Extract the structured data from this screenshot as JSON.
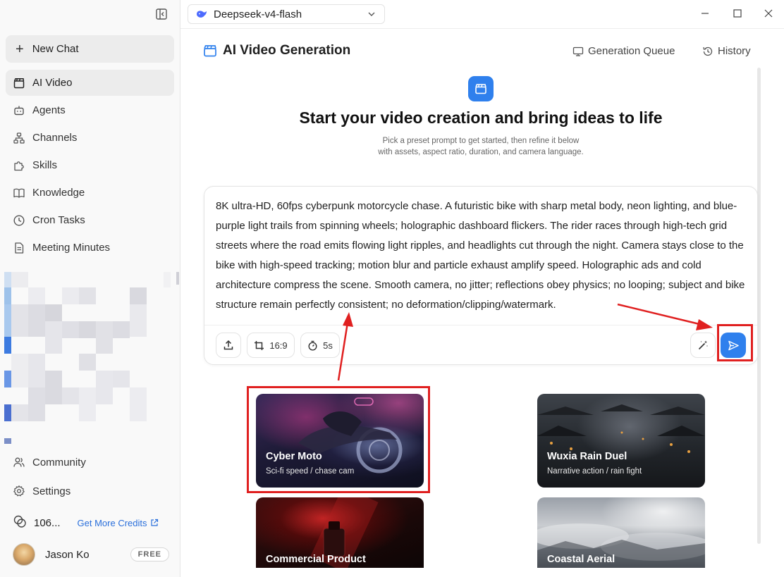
{
  "window": {
    "model_name": "Deepseek-v4-flash"
  },
  "sidebar": {
    "new_chat": "New Chat",
    "items": [
      {
        "label": "AI Video",
        "icon": "clapperboard-icon"
      },
      {
        "label": "Agents",
        "icon": "robot-icon"
      },
      {
        "label": "Channels",
        "icon": "network-icon"
      },
      {
        "label": "Skills",
        "icon": "puzzle-icon"
      },
      {
        "label": "Knowledge",
        "icon": "book-icon"
      },
      {
        "label": "Cron Tasks",
        "icon": "clock-icon"
      },
      {
        "label": "Meeting Minutes",
        "icon": "document-icon"
      }
    ],
    "bottom_items": [
      {
        "label": "Community",
        "icon": "users-icon"
      },
      {
        "label": "Settings",
        "icon": "gear-icon"
      }
    ],
    "credits_count": "106...",
    "get_more_credits": "Get More Credits",
    "user_name": "Jason Ko",
    "plan_badge": "FREE"
  },
  "header": {
    "title": "AI Video Generation",
    "generation_queue": "Generation Queue",
    "history": "History"
  },
  "hero": {
    "title": "Start your video creation and bring ideas to life",
    "subtitle_line1": "Pick a preset prompt to get started, then refine it below",
    "subtitle_line2": "with assets, aspect ratio, duration, and camera language."
  },
  "prompt": {
    "text": "8K ultra-HD, 60fps cyberpunk motorcycle chase. A futuristic bike with sharp metal body, neon lighting, and blue-purple light trails from spinning wheels; holographic dashboard flickers. The rider races through high-tech grid streets where the road emits flowing light ripples, and headlights cut through the night. Camera stays close to the bike with high-speed tracking; motion blur and particle exhaust amplify speed. Holographic ads and cold architecture compress the scene. Smooth camera, no jitter; reflections obey physics; no looping; subject and bike structure remain perfectly consistent; no deformation/clipping/watermark.",
    "aspect_ratio": "16:9",
    "duration": "5s"
  },
  "presets": [
    {
      "title": "Cyber Moto",
      "subtitle": "Sci-fi speed / chase cam"
    },
    {
      "title": "Wuxia Rain Duel",
      "subtitle": "Narrative action / rain fight"
    },
    {
      "title": "Commercial Product",
      "subtitle": ""
    },
    {
      "title": "Coastal Aerial",
      "subtitle": ""
    }
  ],
  "colors": {
    "accent": "#2f80ed",
    "annotation_red": "#e02020"
  }
}
